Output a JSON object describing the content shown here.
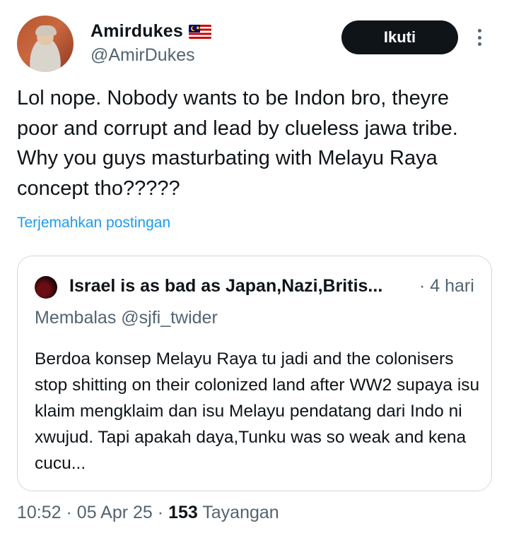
{
  "author": {
    "display_name": "Amirdukes",
    "handle": "@AmirDukes",
    "flag_icon": "malaysia-flag-icon"
  },
  "follow_button": {
    "label": "Ikuti",
    "color": "#0f1419"
  },
  "tweet": {
    "text": "Lol nope. Nobody wants to be Indon bro, theyre poor and corrupt and lead by clueless jawa tribe. Why you guys masturbating with Melayu Raya concept tho?????",
    "translate_label": "Terjemahkan postingan"
  },
  "quote": {
    "name": "Israel is as bad as Japan,Nazi,Britis...",
    "time": "· 4 hari",
    "reply_to": "Membalas @sjfi_twider",
    "text": "Berdoa konsep Melayu Raya tu jadi and the colonisers stop shitting on their colonized land after WW2 supaya isu klaim mengklaim dan isu Melayu pendatang dari Indo ni xwujud. Tapi apakah daya,Tunku was so weak and kena cucu..."
  },
  "meta": {
    "time": "10:52",
    "sep1": "·",
    "date": "05 Apr 25",
    "sep2": "·",
    "views_count": "153",
    "views_label": "Tayangan"
  },
  "colors": {
    "link": "#1d9bf0",
    "secondary_text": "#536471",
    "border": "#cfd9de"
  }
}
